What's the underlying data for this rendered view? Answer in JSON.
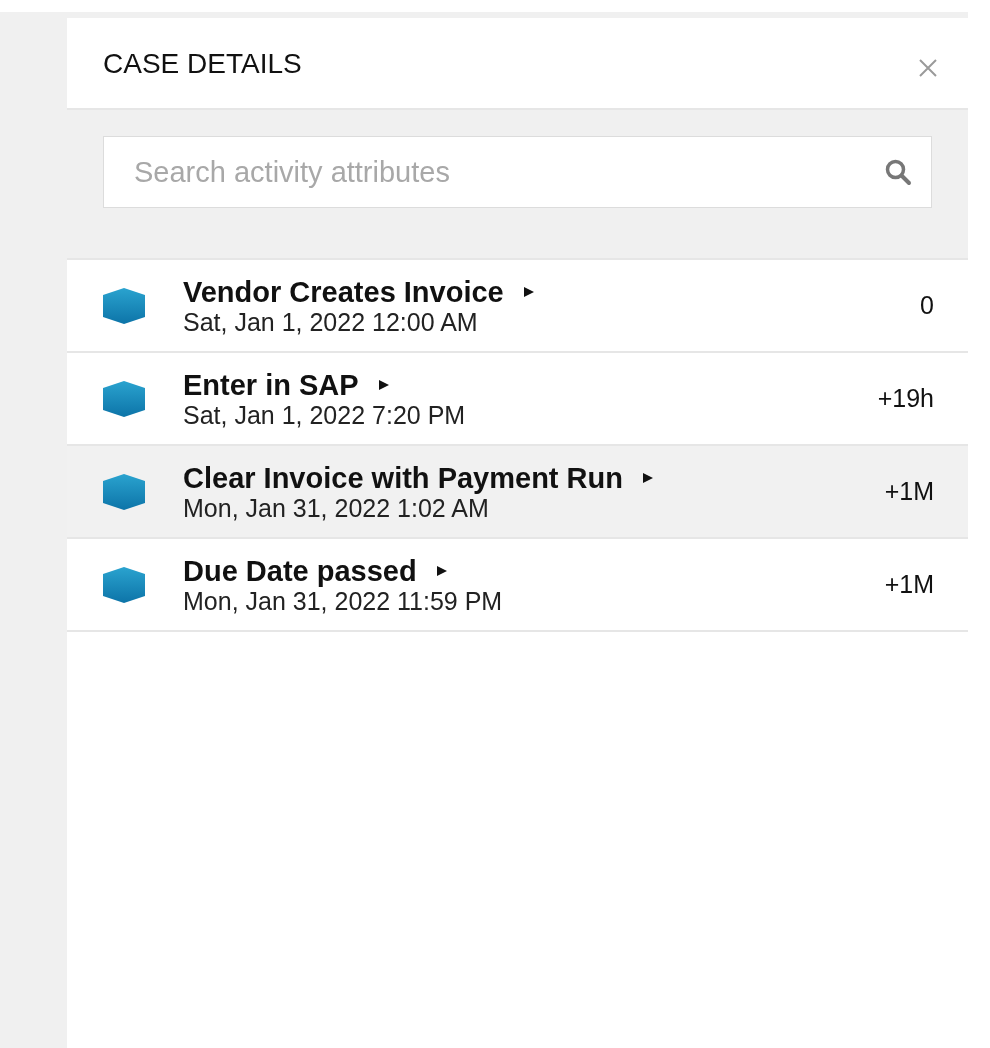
{
  "panel": {
    "title": "CASE DETAILS"
  },
  "search": {
    "placeholder": "Search activity attributes"
  },
  "activities": [
    {
      "name": "Vendor Creates Invoice",
      "timestamp": "Sat, Jan 1, 2022 12:00 AM",
      "delta": "0",
      "selected": false
    },
    {
      "name": "Enter in SAP",
      "timestamp": "Sat, Jan 1, 2022 7:20 PM",
      "delta": "+19h",
      "selected": false
    },
    {
      "name": "Clear Invoice with Payment Run",
      "timestamp": "Mon, Jan 31, 2022 1:02 AM",
      "delta": "+1M",
      "selected": true
    },
    {
      "name": "Due Date passed",
      "timestamp": "Mon, Jan 31, 2022 11:59 PM",
      "delta": "+1M",
      "selected": false
    }
  ]
}
